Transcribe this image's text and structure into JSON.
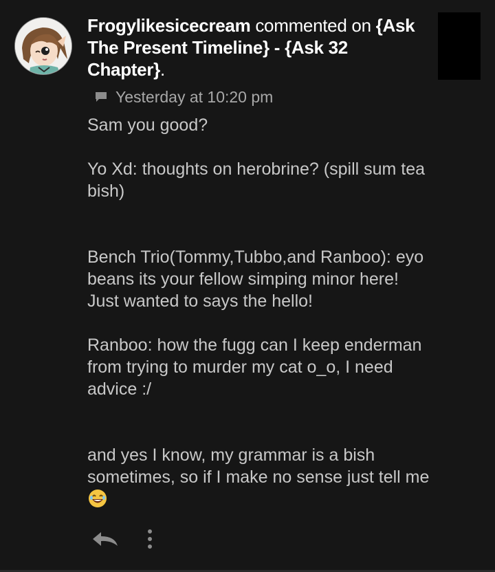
{
  "notification": {
    "username": "Frogylikesicecream",
    "action_text": " commented on ",
    "story_title": "{Ask The Present Timeline} - {Ask 32 Chapter}",
    "end_punct": ".",
    "timestamp": "Yesterday at 10:20 pm",
    "comment_paragraphs": [
      "Sam you good?",
      "Yo Xd: thoughts on herobrine? (spill sum tea bish)",
      "Bench Trio(Tommy,Tubbo,and Ranboo): eyo beans its your fellow simping minor here! Just wanted to says the hello!",
      "Ranboo: how the fugg can I keep enderman from trying to murder my cat o_o, I need advice :/",
      "and yes I know, my grammar is a bish sometimes, so if I make no sense just tell me"
    ],
    "icons": {
      "meta": "chat-bubble-icon",
      "emoji": "laughing-emoji-icon",
      "reply": "reply-arrow-icon",
      "more": "more-vertical-icon"
    }
  },
  "colors": {
    "background": "#161616",
    "headline_text": "#ffffff",
    "body_text": "#c8c8c8",
    "meta_text": "#a8a8a8",
    "icon": "#8c8c8c"
  }
}
